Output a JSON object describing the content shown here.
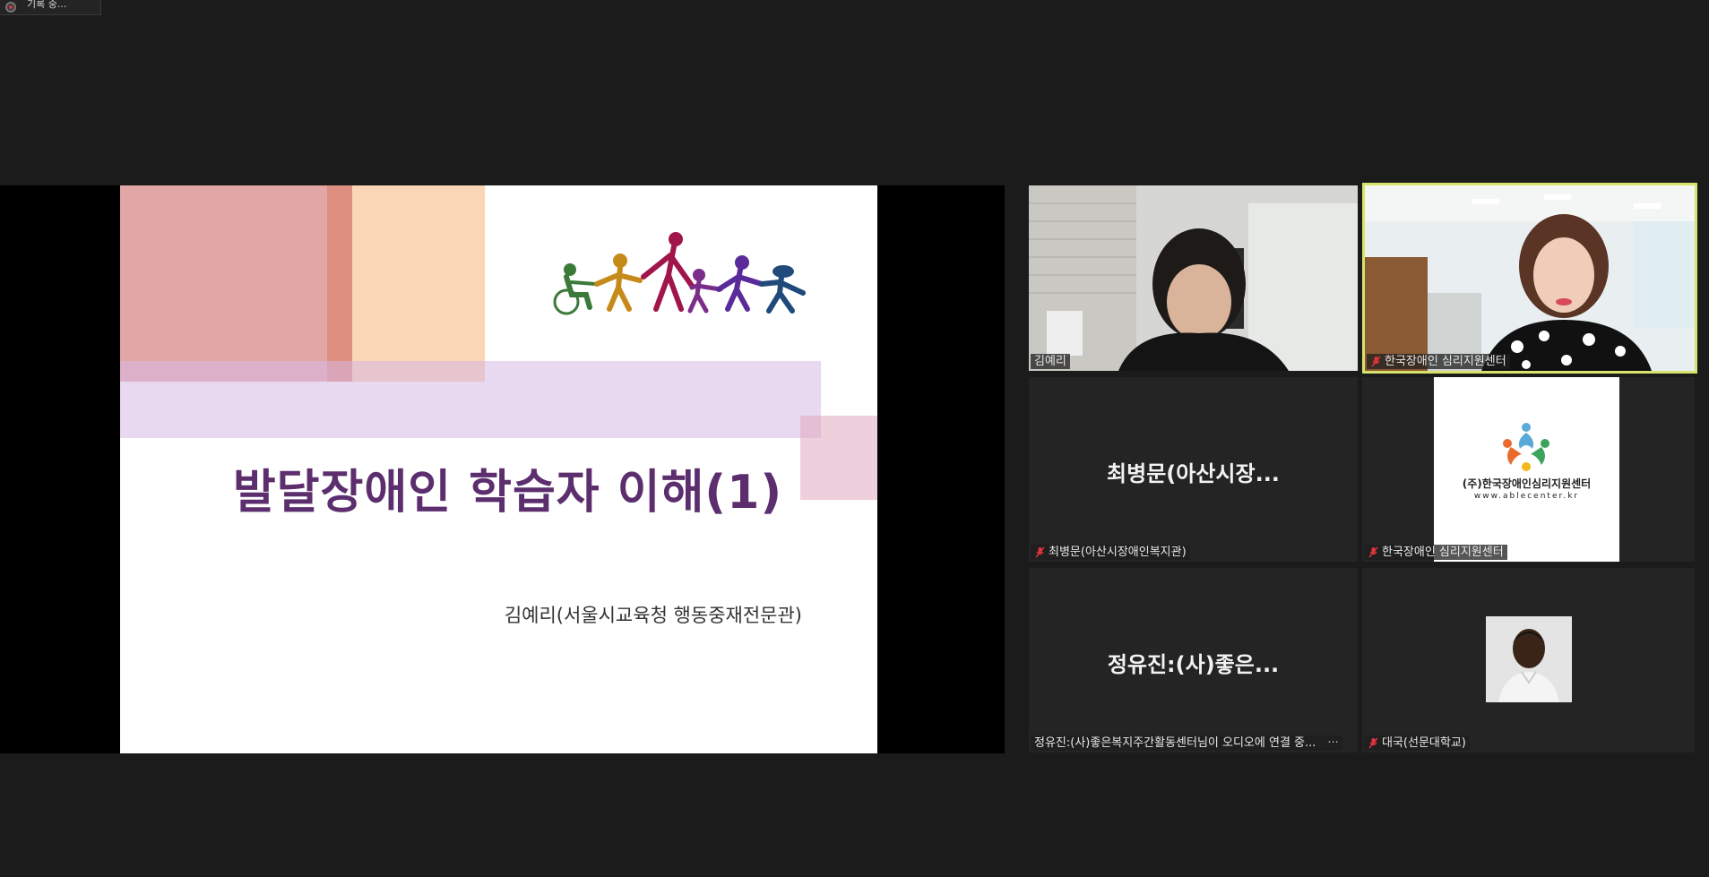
{
  "recording": {
    "label": "기록 중..."
  },
  "slide": {
    "title": "발달장애인 학습자 이해(1)",
    "subtitle": "김예리(서울시교육청 행동중재전문관)"
  },
  "participants": [
    {
      "name": "김예리",
      "muted": false,
      "type": "video"
    },
    {
      "name": "한국장애인 심리지원센터",
      "muted": true,
      "type": "video",
      "active_speaker": true
    },
    {
      "name": "최병문(아산시장애인복지관)",
      "display_name": "최병문(아산시장...",
      "muted": true,
      "type": "name"
    },
    {
      "name": "한국장애인 심리지원센터",
      "muted": true,
      "type": "logo",
      "logo_text": "(주)한국장애인심리지원센터",
      "logo_url": "www.ablecenter.kr"
    },
    {
      "name": "정유진:(사)좋은복지주간활동센터님이 오디오에 연결 중...",
      "display_name": "정유진:(사)좋은...",
      "muted": false,
      "type": "name",
      "menu": "···"
    },
    {
      "name": "대국(선문대학교)",
      "muted": true,
      "type": "avatar"
    }
  ],
  "colors": {
    "active_border": "#d7e36a",
    "slide_title": "#5c2e6e",
    "mute_red": "#e0333c"
  }
}
